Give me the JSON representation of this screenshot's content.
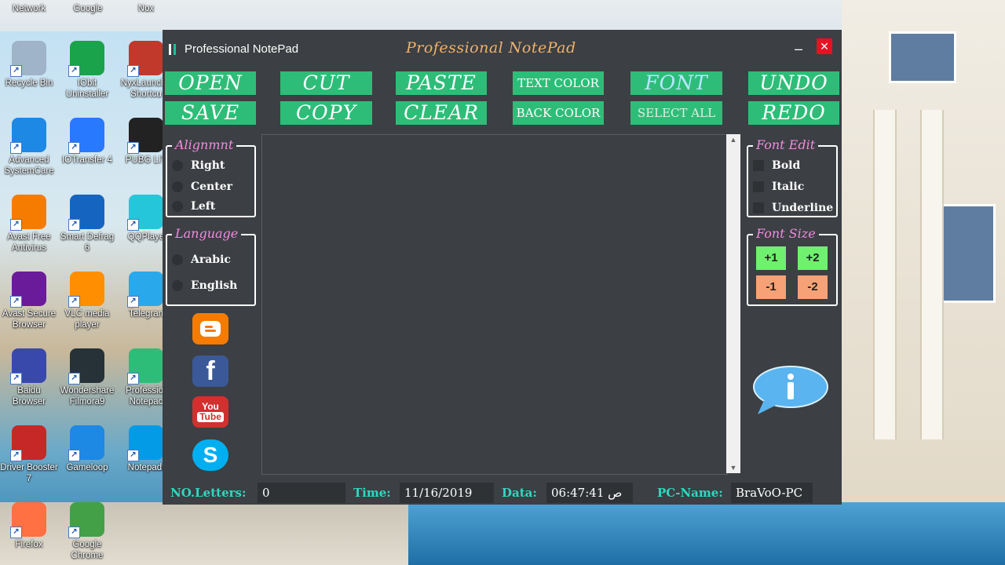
{
  "desktop": {
    "top_labels": [
      "Network",
      "Google",
      "Nox"
    ],
    "icons": [
      {
        "label": "Recycle Bin",
        "icon": "recycle-bin-icon",
        "color": "#9fb4c8"
      },
      {
        "label": "IObit Uninstaller",
        "icon": "iobit-icon",
        "color": "#1aa34a"
      },
      {
        "label": "NyxLaunch - Shortcu",
        "icon": "nyx-icon",
        "color": "#c0392b"
      },
      {
        "label": "Advanced SystemCare",
        "icon": "advanced-systemcare-icon",
        "color": "#1e88e5"
      },
      {
        "label": "IOTransfer 4",
        "icon": "iotransfer-icon",
        "color": "#2979ff"
      },
      {
        "label": "PUBG LIT",
        "icon": "pubg-icon",
        "color": "#222222"
      },
      {
        "label": "Avast Free Antivirus",
        "icon": "avast-icon",
        "color": "#f57c00"
      },
      {
        "label": "Smart Defrag 6",
        "icon": "smart-defrag-icon",
        "color": "#1565c0"
      },
      {
        "label": "QQPlaye",
        "icon": "qqplayer-icon",
        "color": "#26c6da"
      },
      {
        "label": "Avast Secure Browser",
        "icon": "avast-browser-icon",
        "color": "#6a1b9a"
      },
      {
        "label": "VLC media player",
        "icon": "vlc-icon",
        "color": "#ff8f00"
      },
      {
        "label": "Telegran",
        "icon": "telegram-icon",
        "color": "#29a9eb"
      },
      {
        "label": "Baidu Browser",
        "icon": "baidu-icon",
        "color": "#3949ab"
      },
      {
        "label": "Wondershare Filmora9",
        "icon": "filmora-icon",
        "color": "#263238"
      },
      {
        "label": "Professior Notepac",
        "icon": "professional-notepad-icon",
        "color": "#2ebd78"
      },
      {
        "label": "Driver Booster 7",
        "icon": "driver-booster-icon",
        "color": "#c62828"
      },
      {
        "label": "Gameloop",
        "icon": "gameloop-icon",
        "color": "#1e88e5"
      },
      {
        "label": "Notepadt",
        "icon": "notepad-icon",
        "color": "#039be5"
      },
      {
        "label": "Firefox",
        "icon": "firefox-icon",
        "color": "#ff7043"
      },
      {
        "label": "Google Chrome",
        "icon": "chrome-icon",
        "color": "#43a047"
      }
    ]
  },
  "app": {
    "title": "Professional NotePad",
    "center_title": "Professional NotePad",
    "minimize": "–",
    "close": "✕",
    "buttons": {
      "open": "OPEN",
      "save": "SAVE",
      "cut": "CUT",
      "copy": "COPY",
      "paste": "PASTE",
      "clear": "CLEAR",
      "text_color": "TEXT COLOR",
      "back_color": "BACK COLOR",
      "font": "FONT",
      "select_all": "SELECT ALL",
      "undo": "UNDO",
      "redo": "REDO"
    },
    "alignment": {
      "title": "Alignmnt",
      "options": [
        "Right",
        "Center",
        "Left"
      ]
    },
    "language": {
      "title": "Language",
      "options": [
        "Arabic",
        "English"
      ]
    },
    "font_edit": {
      "title": "Font Edit",
      "options": [
        "Bold",
        "Italic",
        "Underline"
      ]
    },
    "font_size": {
      "title": "Font Size",
      "buttons": [
        "+1",
        "+2",
        "-1",
        "-2"
      ]
    },
    "social": [
      "blogger-icon",
      "facebook-icon",
      "youtube-icon",
      "skype-icon"
    ],
    "status": {
      "letters_label": "NO.Letters:",
      "letters_value": "0",
      "time_label": "Time:",
      "time_value": "11/16/2019",
      "date_label": "Data:",
      "date_value": "06:47:41 ص",
      "pc_label": "PC-Name:",
      "pc_value": "BraVoO-PC"
    },
    "colors": {
      "button": "#2ebd78",
      "group_title": "#f28be0",
      "status_label": "#2ed8c0",
      "window_bg": "#3c3f43"
    }
  }
}
